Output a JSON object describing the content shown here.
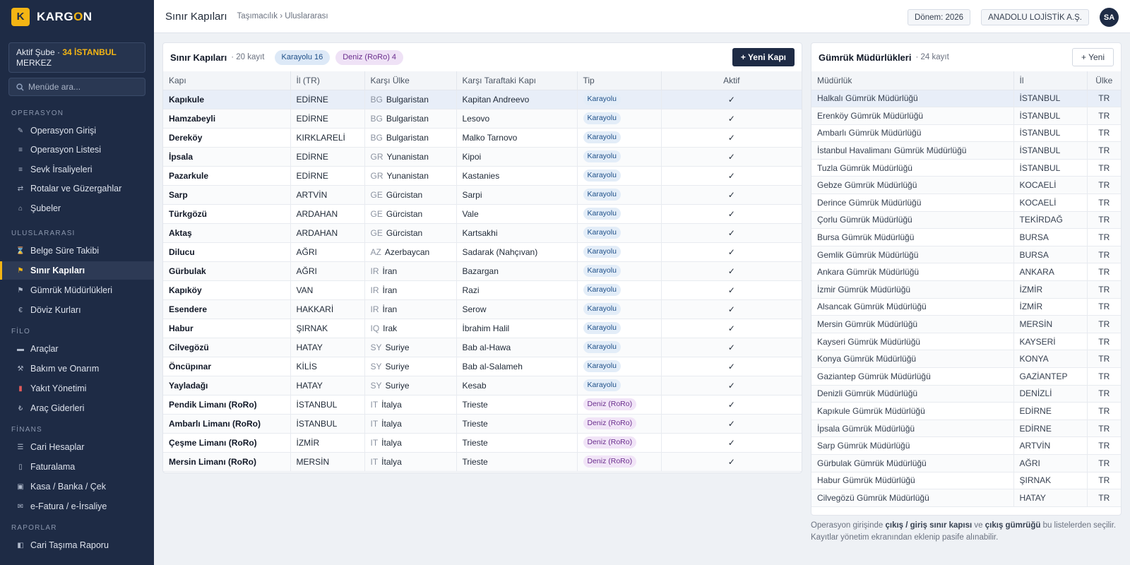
{
  "brand": {
    "mark": "K",
    "name_a": "KARG",
    "name_b": "O",
    "name_c": "N"
  },
  "branch": {
    "prefix": "Aktif Şube · ",
    "code": "34 İSTANBUL",
    "suffix": "MERKEZ"
  },
  "search": {
    "placeholder": "Menüde ara..."
  },
  "nav": {
    "sections": [
      "OPERASYON",
      "ULUSLARARASI",
      "FİLO",
      "FİNANS",
      "RAPORLAR"
    ],
    "items": [
      {
        "label": "Operasyon Girişi",
        "icon": "pencil-icon"
      },
      {
        "label": "Operasyon Listesi",
        "icon": "list-icon"
      },
      {
        "label": "Sevk İrsaliyeleri",
        "icon": "list-icon"
      },
      {
        "label": "Rotalar ve Güzergahlar",
        "icon": "route-icon"
      },
      {
        "label": "Şubeler",
        "icon": "home-icon"
      },
      {
        "label": "Belge Süre Takibi",
        "icon": "hourglass-icon"
      },
      {
        "label": "Sınır Kapıları",
        "icon": "flag-icon",
        "active": true
      },
      {
        "label": "Gümrük Müdürlükleri",
        "icon": "flag-icon"
      },
      {
        "label": "Döviz Kurları",
        "icon": "euro-icon"
      },
      {
        "label": "Araçlar",
        "icon": "truck-icon"
      },
      {
        "label": "Bakım ve Onarım",
        "icon": "wrench-icon"
      },
      {
        "label": "Yakıt Yönetimi",
        "icon": "fuel-icon"
      },
      {
        "label": "Araç Giderleri",
        "icon": "lira-icon"
      },
      {
        "label": "Cari Hesaplar",
        "icon": "ledger-icon"
      },
      {
        "label": "Faturalama",
        "icon": "receipt-icon"
      },
      {
        "label": "Kasa / Banka / Çek",
        "icon": "bank-icon"
      },
      {
        "label": "e-Fatura / e-İrsaliye",
        "icon": "mail-icon"
      },
      {
        "label": "Cari Taşıma Raporu",
        "icon": "report-icon"
      }
    ]
  },
  "topbar": {
    "title": "Sınır Kapıları",
    "breadcrumb": "Taşımacılık › Uluslararası",
    "period": "Dönem: 2026",
    "company": "ANADOLU LOJİSTİK A.Ş.",
    "avatar": "SA"
  },
  "gates": {
    "title": "Sınır Kapıları",
    "count": "· 20 kayıt",
    "pill_road": "Karayolu 16",
    "pill_sea": "Deniz (RoRo) 4",
    "new_button": "+ Yeni Kapı",
    "columns": [
      "Kapı",
      "İl (TR)",
      "Karşı Ülke",
      "Karşı Taraftaki Kapı",
      "Tip",
      "Aktif"
    ],
    "rows": [
      {
        "gate": "Kapıkule",
        "city": "EDİRNE",
        "cc": "BG",
        "country": "Bulgaristan",
        "other": "Kapitan Andreevo",
        "type": "Karayolu",
        "kind": "road",
        "active": "✓"
      },
      {
        "gate": "Hamzabeyli",
        "city": "EDİRNE",
        "cc": "BG",
        "country": "Bulgaristan",
        "other": "Lesovo",
        "type": "Karayolu",
        "kind": "road",
        "active": "✓"
      },
      {
        "gate": "Dereköy",
        "city": "KIRKLARELİ",
        "cc": "BG",
        "country": "Bulgaristan",
        "other": "Malko Tarnovo",
        "type": "Karayolu",
        "kind": "road",
        "active": "✓"
      },
      {
        "gate": "İpsala",
        "city": "EDİRNE",
        "cc": "GR",
        "country": "Yunanistan",
        "other": "Kipoi",
        "type": "Karayolu",
        "kind": "road",
        "active": "✓"
      },
      {
        "gate": "Pazarkule",
        "city": "EDİRNE",
        "cc": "GR",
        "country": "Yunanistan",
        "other": "Kastanies",
        "type": "Karayolu",
        "kind": "road",
        "active": "✓"
      },
      {
        "gate": "Sarp",
        "city": "ARTVİN",
        "cc": "GE",
        "country": "Gürcistan",
        "other": "Sarpi",
        "type": "Karayolu",
        "kind": "road",
        "active": "✓"
      },
      {
        "gate": "Türkgözü",
        "city": "ARDAHAN",
        "cc": "GE",
        "country": "Gürcistan",
        "other": "Vale",
        "type": "Karayolu",
        "kind": "road",
        "active": "✓"
      },
      {
        "gate": "Aktaş",
        "city": "ARDAHAN",
        "cc": "GE",
        "country": "Gürcistan",
        "other": "Kartsakhi",
        "type": "Karayolu",
        "kind": "road",
        "active": "✓"
      },
      {
        "gate": "Dilucu",
        "city": "AĞRI",
        "cc": "AZ",
        "country": "Azerbaycan",
        "other": "Sadarak (Nahçıvan)",
        "type": "Karayolu",
        "kind": "road",
        "active": "✓"
      },
      {
        "gate": "Gürbulak",
        "city": "AĞRI",
        "cc": "IR",
        "country": "İran",
        "other": "Bazargan",
        "type": "Karayolu",
        "kind": "road",
        "active": "✓"
      },
      {
        "gate": "Kapıköy",
        "city": "VAN",
        "cc": "IR",
        "country": "İran",
        "other": "Razi",
        "type": "Karayolu",
        "kind": "road",
        "active": "✓"
      },
      {
        "gate": "Esendere",
        "city": "HAKKARİ",
        "cc": "IR",
        "country": "İran",
        "other": "Serow",
        "type": "Karayolu",
        "kind": "road",
        "active": "✓"
      },
      {
        "gate": "Habur",
        "city": "ŞIRNAK",
        "cc": "IQ",
        "country": "Irak",
        "other": "İbrahim Halil",
        "type": "Karayolu",
        "kind": "road",
        "active": "✓"
      },
      {
        "gate": "Cilvegözü",
        "city": "HATAY",
        "cc": "SY",
        "country": "Suriye",
        "other": "Bab al-Hawa",
        "type": "Karayolu",
        "kind": "road",
        "active": "✓"
      },
      {
        "gate": "Öncüpınar",
        "city": "KİLİS",
        "cc": "SY",
        "country": "Suriye",
        "other": "Bab al-Salameh",
        "type": "Karayolu",
        "kind": "road",
        "active": "✓"
      },
      {
        "gate": "Yayladağı",
        "city": "HATAY",
        "cc": "SY",
        "country": "Suriye",
        "other": "Kesab",
        "type": "Karayolu",
        "kind": "road",
        "active": "✓"
      },
      {
        "gate": "Pendik Limanı (RoRo)",
        "city": "İSTANBUL",
        "cc": "IT",
        "country": "İtalya",
        "other": "Trieste",
        "type": "Deniz (RoRo)",
        "kind": "sea",
        "active": "✓"
      },
      {
        "gate": "Ambarlı Limanı (RoRo)",
        "city": "İSTANBUL",
        "cc": "IT",
        "country": "İtalya",
        "other": "Trieste",
        "type": "Deniz (RoRo)",
        "kind": "sea",
        "active": "✓"
      },
      {
        "gate": "Çeşme Limanı (RoRo)",
        "city": "İZMİR",
        "cc": "IT",
        "country": "İtalya",
        "other": "Trieste",
        "type": "Deniz (RoRo)",
        "kind": "sea",
        "active": "✓"
      },
      {
        "gate": "Mersin Limanı (RoRo)",
        "city": "MERSİN",
        "cc": "IT",
        "country": "İtalya",
        "other": "Trieste",
        "type": "Deniz (RoRo)",
        "kind": "sea",
        "active": "✓"
      }
    ]
  },
  "customs": {
    "title": "Gümrük Müdürlükleri",
    "count": "· 24 kayıt",
    "new_button": "+ Yeni",
    "columns": [
      "Müdürlük",
      "İl",
      "Ülke"
    ],
    "rows": [
      {
        "name": "Halkalı Gümrük Müdürlüğü",
        "city": "İSTANBUL",
        "country": "TR"
      },
      {
        "name": "Erenköy Gümrük Müdürlüğü",
        "city": "İSTANBUL",
        "country": "TR"
      },
      {
        "name": "Ambarlı Gümrük Müdürlüğü",
        "city": "İSTANBUL",
        "country": "TR"
      },
      {
        "name": "İstanbul Havalimanı Gümrük Müdürlüğü",
        "city": "İSTANBUL",
        "country": "TR"
      },
      {
        "name": "Tuzla Gümrük Müdürlüğü",
        "city": "İSTANBUL",
        "country": "TR"
      },
      {
        "name": "Gebze Gümrük Müdürlüğü",
        "city": "KOCAELİ",
        "country": "TR"
      },
      {
        "name": "Derince Gümrük Müdürlüğü",
        "city": "KOCAELİ",
        "country": "TR"
      },
      {
        "name": "Çorlu Gümrük Müdürlüğü",
        "city": "TEKİRDAĞ",
        "country": "TR"
      },
      {
        "name": "Bursa Gümrük Müdürlüğü",
        "city": "BURSA",
        "country": "TR"
      },
      {
        "name": "Gemlik Gümrük Müdürlüğü",
        "city": "BURSA",
        "country": "TR"
      },
      {
        "name": "Ankara Gümrük Müdürlüğü",
        "city": "ANKARA",
        "country": "TR"
      },
      {
        "name": "İzmir Gümrük Müdürlüğü",
        "city": "İZMİR",
        "country": "TR"
      },
      {
        "name": "Alsancak Gümrük Müdürlüğü",
        "city": "İZMİR",
        "country": "TR"
      },
      {
        "name": "Mersin Gümrük Müdürlüğü",
        "city": "MERSİN",
        "country": "TR"
      },
      {
        "name": "Kayseri Gümrük Müdürlüğü",
        "city": "KAYSERİ",
        "country": "TR"
      },
      {
        "name": "Konya Gümrük Müdürlüğü",
        "city": "KONYA",
        "country": "TR"
      },
      {
        "name": "Gaziantep Gümrük Müdürlüğü",
        "city": "GAZİANTEP",
        "country": "TR"
      },
      {
        "name": "Denizli Gümrük Müdürlüğü",
        "city": "DENİZLİ",
        "country": "TR"
      },
      {
        "name": "Kapıkule Gümrük Müdürlüğü",
        "city": "EDİRNE",
        "country": "TR"
      },
      {
        "name": "İpsala Gümrük Müdürlüğü",
        "city": "EDİRNE",
        "country": "TR"
      },
      {
        "name": "Sarp Gümrük Müdürlüğü",
        "city": "ARTVİN",
        "country": "TR"
      },
      {
        "name": "Gürbulak Gümrük Müdürlüğü",
        "city": "AĞRI",
        "country": "TR"
      },
      {
        "name": "Habur Gümrük Müdürlüğü",
        "city": "ŞIRNAK",
        "country": "TR"
      },
      {
        "name": "Cilvegözü Gümrük Müdürlüğü",
        "city": "HATAY",
        "country": "TR"
      }
    ]
  },
  "note": {
    "p1": "Operasyon girişinde ",
    "b1": "çıkış / giriş sınır kapısı",
    "p2": " ve ",
    "b2": "çıkış gümrüğü",
    "p3": " bu listelerden seçilir. Kayıtlar yönetim ekranından eklenip pasife alınabilir."
  },
  "colors": {
    "sidebar": "#1e2b45",
    "accent": "#f4b514",
    "road_tag": "#e3edf8",
    "sea_tag": "#f1e4f7"
  }
}
